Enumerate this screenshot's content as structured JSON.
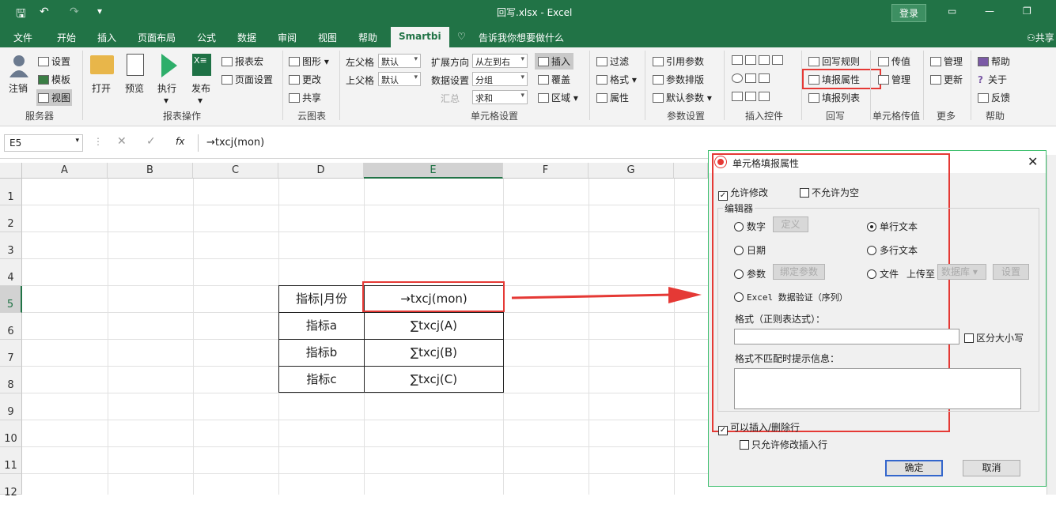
{
  "title_bar": {
    "file_title": "回写.xlsx  -  Excel",
    "login": "登录"
  },
  "tabs": [
    "文件",
    "开始",
    "插入",
    "页面布局",
    "公式",
    "数据",
    "审阅",
    "视图",
    "帮助",
    "Smartbi",
    "告诉我你想要做什么",
    "共享"
  ],
  "ribbon": {
    "server": {
      "logout": "注销",
      "settings": "设置",
      "template": "模板",
      "view": "视图",
      "group": "服务器"
    },
    "report_ops": {
      "open": "打开",
      "preview": "预览",
      "execute": "执行",
      "publish": "发布",
      "report_macro": "报表宏",
      "page_setup": "页面设置",
      "group": "报表操作"
    },
    "cloud_chart": {
      "chart": "图形",
      "change": "更改",
      "share": "共享",
      "group": "云图表"
    },
    "cell_settings": {
      "left_parent": "左父格",
      "left_parent_val": "默认",
      "top_parent": "上父格",
      "top_parent_val": "默认",
      "expand_dir": "扩展方向",
      "expand_dir_val": "从左到右",
      "data_settings": "数据设置",
      "data_settings_val": "分组",
      "summary": "汇总",
      "summary_val": "求和",
      "insert": "插入",
      "cover": "覆盖",
      "region": "区域",
      "group": "单元格设置"
    },
    "filter": {
      "filter": "过滤",
      "format": "格式",
      "property": "属性"
    },
    "params": {
      "ref_params": "引用参数",
      "param_layout": "参数排版",
      "default_params": "默认参数",
      "group": "参数设置"
    },
    "controls": {
      "group": "插入控件"
    },
    "writeback": {
      "rules": "回写规则",
      "fill_props": "填报属性",
      "fill_list": "填报列表",
      "group": "回写"
    },
    "cell_pass": {
      "pass": "传值",
      "manage": "管理",
      "group": "单元格传值"
    },
    "more": {
      "manage": "管理",
      "update": "更新",
      "group": "更多"
    },
    "help": {
      "help": "帮助",
      "about": "关于",
      "feedback": "反馈",
      "group": "帮助"
    }
  },
  "formula_bar": {
    "name_box": "E5",
    "fx": "fx",
    "formula": "→txcj(mon)"
  },
  "sheet": {
    "columns": [
      "A",
      "B",
      "C",
      "D",
      "E",
      "F",
      "G"
    ],
    "rows": [
      "1",
      "2",
      "3",
      "4",
      "5",
      "6",
      "7",
      "8",
      "9",
      "10",
      "11",
      "12"
    ],
    "cells": [
      [
        "指标|月份",
        "→txcj(mon)"
      ],
      [
        "指标a",
        "∑txcj(A)"
      ],
      [
        "指标b",
        "∑txcj(B)"
      ],
      [
        "指标c",
        "∑txcj(C)"
      ]
    ]
  },
  "dialog": {
    "title": "单元格填报属性",
    "allow_modify": "允许修改",
    "not_null": "不允许为空",
    "editor_label": "编辑器",
    "number": "数字",
    "define": "定义",
    "single_text": "单行文本",
    "date": "日期",
    "multi_text": "多行文本",
    "param": "参数",
    "bind_param": "绑定参数",
    "file": "文件",
    "upload_to": "上传至",
    "database": "数据库",
    "setting": "设置",
    "excel_validation": "Excel 数据验证（序列）",
    "format_regex": "格式（正则表达式）：",
    "case_sensitive": "区分大小写",
    "mismatch_tip": "格式不匹配时提示信息：",
    "allow_insert_delete": "可以插入/删除行",
    "only_modify_insert": "只允许修改插入行",
    "ok": "确定",
    "cancel": "取消"
  },
  "colors": {
    "excel_green": "#217346",
    "highlight_red": "#e53935",
    "selection_green": "#217346"
  }
}
